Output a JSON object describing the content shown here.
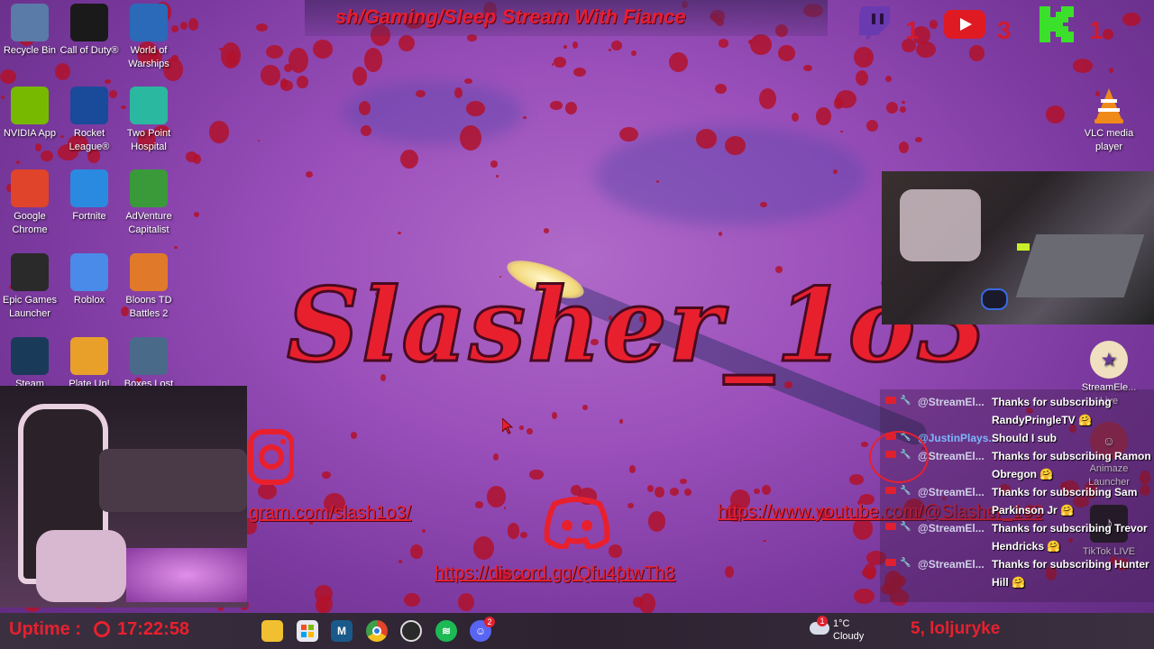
{
  "stream_title": "sh/Gaming/Sleep Stream With Fiance",
  "big_name": "Slasher_1o3",
  "desktop_icons": [
    {
      "label": "Recycle Bin",
      "icon": "recycle-bin-icon",
      "color": "#5a7aa8"
    },
    {
      "label": "Call of Duty®",
      "icon": "call-of-duty-icon",
      "color": "#1a1a1a"
    },
    {
      "label": "World of Warships",
      "icon": "world-of-warships-icon",
      "color": "#2a6ab8"
    },
    {
      "label": "NVIDIA App",
      "icon": "nvidia-icon",
      "color": "#76b900"
    },
    {
      "label": "Rocket League®",
      "icon": "rocket-league-icon",
      "color": "#1a4a9a"
    },
    {
      "label": "Two Point Hospital",
      "icon": "two-point-hospital-icon",
      "color": "#2ab8a0"
    },
    {
      "label": "Google Chrome",
      "icon": "chrome-icon",
      "color": "#e0442a"
    },
    {
      "label": "Fortnite",
      "icon": "fortnite-icon",
      "color": "#2a8ae0"
    },
    {
      "label": "AdVenture Capitalist",
      "icon": "adventure-capitalist-icon",
      "color": "#3a9a3a"
    },
    {
      "label": "Epic Games Launcher",
      "icon": "epic-games-icon",
      "color": "#2a2a2a"
    },
    {
      "label": "Roblox",
      "icon": "roblox-icon",
      "color": "#4a8ae8"
    },
    {
      "label": "Bloons TD Battles 2",
      "icon": "bloons-icon",
      "color": "#e07a2a"
    },
    {
      "label": "Steam",
      "icon": "steam-icon",
      "color": "#1a3a5a"
    },
    {
      "label": "Plate Up!",
      "icon": "plateup-icon",
      "color": "#e8a02a"
    },
    {
      "label": "Boxes Lost",
      "icon": "boxes-lost-icon",
      "color": "#4a6a8a"
    }
  ],
  "right_icons": [
    {
      "label": "VLC media player",
      "icon": "vlc-icon"
    },
    {
      "label": "StreamEle... Live",
      "icon": "streamelements-icon"
    },
    {
      "label": "Animaze Launcher",
      "icon": "animaze-icon"
    },
    {
      "label": "TikTok LIVE",
      "icon": "tiktok-icon"
    }
  ],
  "social_counts": {
    "twitch": "1",
    "youtube": "3",
    "kick": "1"
  },
  "links": {
    "instagram": "gram.com/slash1o3/",
    "youtube": "https://www.youtube.com/@Slasher_1o3",
    "discord": "https://discord.gg/Qfu4ptwTh8"
  },
  "chat": [
    {
      "user": "@StreamEl...",
      "msg": "Thanks for subscribing RandyPringleTV 🤗"
    },
    {
      "user": "@JustinPlays...",
      "msg": "Should I sub"
    },
    {
      "user": "@StreamEl...",
      "msg": "Thanks for subscribing Ramon Obregon 🤗"
    },
    {
      "user": "@StreamEl...",
      "msg": "Thanks for subscribing Sam Parkinson Jr 🤗"
    },
    {
      "user": "@StreamEl...",
      "msg": "Thanks for subscribing Trevor Hendricks 🤗"
    },
    {
      "user": "@StreamEl...",
      "msg": "Thanks for subscribing Hunter Hill 🤗"
    }
  ],
  "taskbar": {
    "uptime_label": "Uptime :",
    "uptime_value": "17:22:58",
    "weather_temp": "1°C",
    "weather_desc": "Cloudy",
    "weather_badge": "1",
    "discord_badge": "2",
    "ticker": "5, loljuryke"
  }
}
